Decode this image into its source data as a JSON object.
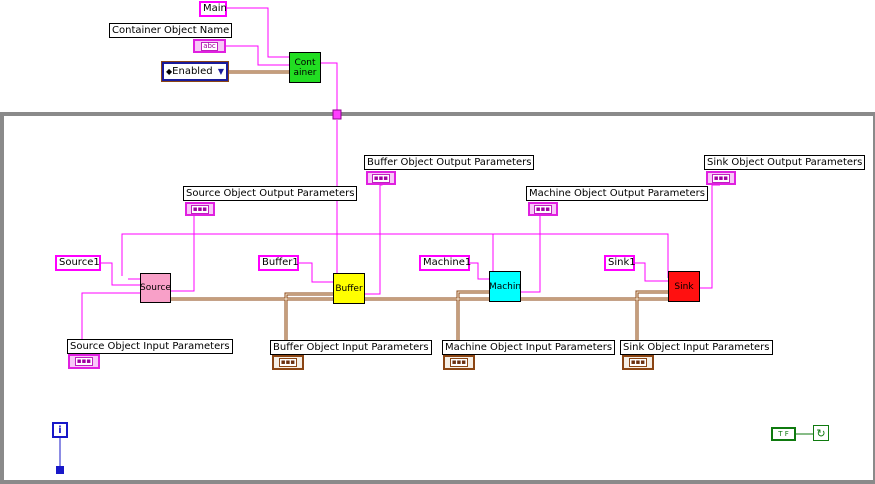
{
  "constants": {
    "main": "Main",
    "container_object_name": "Container Object Name",
    "enum_value": "Enabled",
    "source1": "Source1",
    "buffer1": "Buffer1",
    "machine1": "Machine1",
    "sink1": "Sink1"
  },
  "nodes": {
    "container": "Container",
    "source": "Source",
    "buffer": "Buffer",
    "machine": "Machin",
    "sink": "Sink"
  },
  "labels": {
    "source_output": "Source Object Output Parameters",
    "buffer_output": "Buffer Object Output Parameters",
    "machine_output": "Machine Object Output Parameters",
    "sink_output": "Sink Object Output Parameters",
    "source_input": "Source Object Input Parameters",
    "buffer_input": "Buffer Object Input Parameters",
    "machine_input": "Machine Object Input Parameters",
    "sink_input": "Sink Object Input Parameters"
  },
  "terminals": {
    "string_glyph": "abc",
    "cluster_glyph": "▪▪▪",
    "iteration": "i",
    "bool_glyph": "T F",
    "stop_glyph": "↻"
  },
  "colors": {
    "string_wire": "#ff00ff",
    "cluster_wire": "#8b4513",
    "loop_border": "#8a8a8a",
    "container_node": "#22dd22",
    "source_node": "#f8a0c8",
    "buffer_node": "#ffff00",
    "machine_node": "#00ffff",
    "sink_node": "#ff1010"
  }
}
